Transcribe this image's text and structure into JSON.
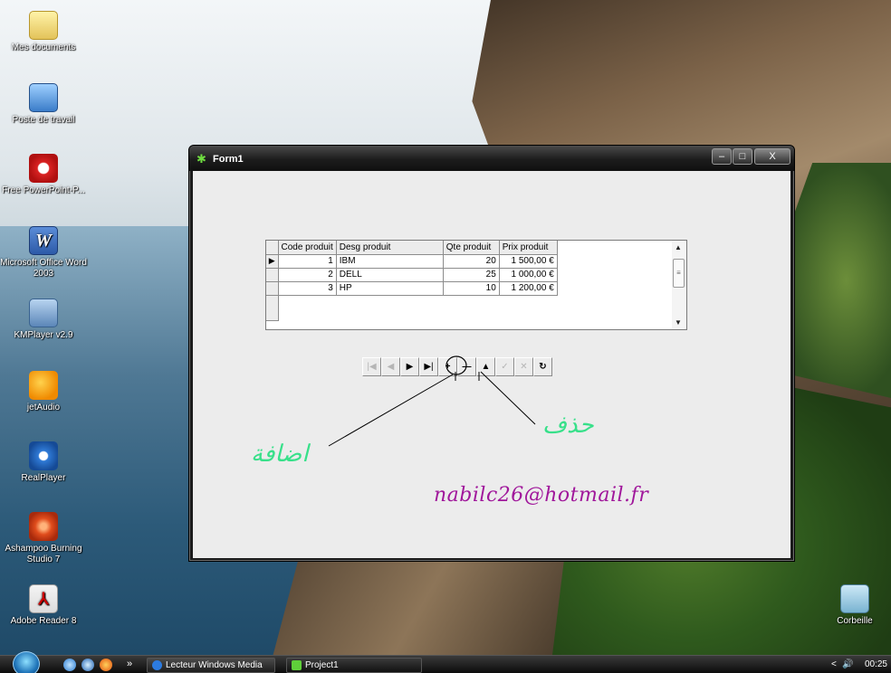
{
  "desktop": {
    "icons": [
      {
        "label": "Mes documents",
        "icon": "folder-documents-icon"
      },
      {
        "label": "Poste de travail",
        "icon": "computer-icon"
      },
      {
        "label": "Free PowerPoint-P...",
        "icon": "free-powerpoint-icon"
      },
      {
        "label": "Microsoft Office Word 2003",
        "icon": "word-icon"
      },
      {
        "label": "KMPlayer v2.9",
        "icon": "kmplayer-icon"
      },
      {
        "label": "jetAudio",
        "icon": "jetaudio-icon"
      },
      {
        "label": "RealPlayer",
        "icon": "realplayer-icon"
      },
      {
        "label": "Ashampoo Burning Studio 7",
        "icon": "ashampoo-icon"
      },
      {
        "label": "Adobe Reader 8",
        "icon": "adobe-reader-icon"
      }
    ],
    "recycle_bin": {
      "label": "Corbeille",
      "icon": "recycle-bin-icon"
    },
    "word_glyph": "W",
    "pdf_glyph": "⅄"
  },
  "window": {
    "title": "Form1",
    "controls": {
      "minimize": "–",
      "maximize": "□",
      "close": "X"
    }
  },
  "grid": {
    "columns": [
      "Code produit",
      "Desg produit",
      "Qte  produit",
      "Prix  produit"
    ],
    "rows": [
      {
        "code": "1",
        "desg": "IBM",
        "qte": "20",
        "prix": "1 500,00 €"
      },
      {
        "code": "2",
        "desg": "DELL",
        "qte": "25",
        "prix": "1 000,00 €"
      },
      {
        "code": "3",
        "desg": "HP",
        "qte": "10",
        "prix": "1 200,00 €"
      }
    ],
    "current_row": 1,
    "row_indicator": "▶"
  },
  "navigator": {
    "buttons": [
      {
        "name": "first",
        "glyph": "|◀",
        "enabled": false
      },
      {
        "name": "prior",
        "glyph": "◀",
        "enabled": false
      },
      {
        "name": "next",
        "glyph": "▶",
        "enabled": true
      },
      {
        "name": "last",
        "glyph": "▶|",
        "enabled": true
      },
      {
        "name": "insert",
        "glyph": "+",
        "enabled": true
      },
      {
        "name": "delete",
        "glyph": "—",
        "enabled": true
      },
      {
        "name": "edit",
        "glyph": "▲",
        "enabled": true
      },
      {
        "name": "post",
        "glyph": "✓",
        "enabled": false
      },
      {
        "name": "cancel",
        "glyph": "✕",
        "enabled": false
      },
      {
        "name": "refresh",
        "glyph": "↻",
        "enabled": true
      }
    ]
  },
  "annotations": {
    "add_label": "اضافة",
    "delete_label": "حذف",
    "email": "nabilc26@hotmail.fr",
    "text_color_arabic": "#38e08a",
    "text_color_email": "#a0179b"
  },
  "taskbar": {
    "more_glyph": "»",
    "tasks": [
      {
        "label": "Lecteur Windows Media"
      },
      {
        "label": "Project1"
      }
    ],
    "tray_arrow": "<",
    "tray_volume": "🔊",
    "clock": "00:25"
  }
}
